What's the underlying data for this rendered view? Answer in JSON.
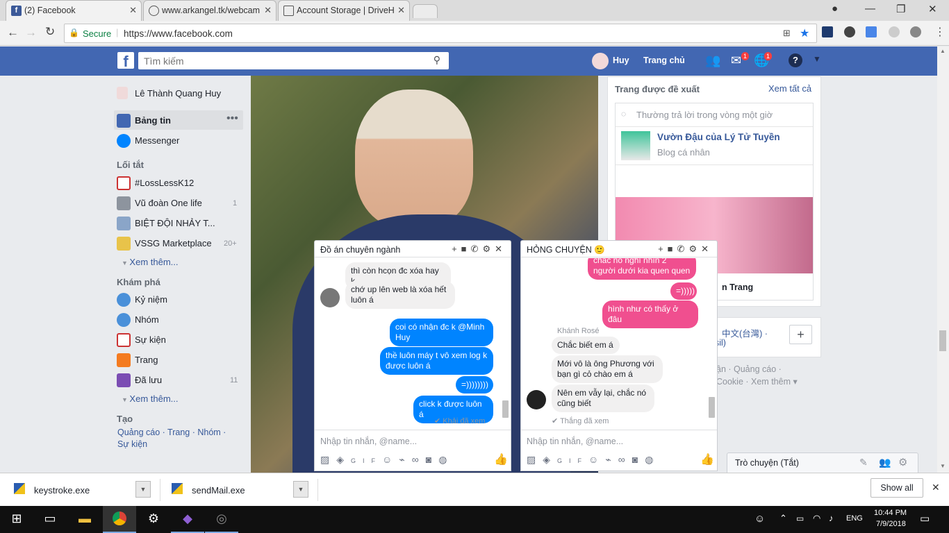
{
  "browser": {
    "tabs": [
      {
        "title": "(2) Facebook"
      },
      {
        "title": "www.arkangel.tk/webcam"
      },
      {
        "title": "Account Storage | DriveH"
      }
    ],
    "secure_label": "Secure",
    "url": "https://www.facebook.com"
  },
  "fb": {
    "search_placeholder": "Tìm kiếm",
    "user": "Huy",
    "home": "Trang chủ",
    "messenger_badge": "1",
    "notif_badge": "1"
  },
  "left": {
    "profile": "Lê Thành Quang Huy",
    "feed": "Bảng tin",
    "messenger": "Messenger",
    "shortcuts_title": "Lối tắt",
    "shortcuts": [
      {
        "label": "#LossLessK12",
        "count": ""
      },
      {
        "label": "Vũ đoàn One life",
        "count": "1"
      },
      {
        "label": "BIỆT ĐỘI NHẢY T...",
        "count": ""
      },
      {
        "label": "VSSG Marketplace",
        "count": "20+"
      }
    ],
    "see_more": "Xem thêm...",
    "explore_title": "Khám phá",
    "explore": [
      {
        "label": "Kỷ niệm",
        "count": ""
      },
      {
        "label": "Nhóm",
        "count": ""
      },
      {
        "label": "Sự kiện",
        "count": ""
      },
      {
        "label": "Trang",
        "count": ""
      },
      {
        "label": "Đã lưu",
        "count": "11"
      }
    ],
    "create_title": "Tạo",
    "create_links": "Quảng cáo · Trang · Nhóm ·",
    "create_links2": "Sự kiện"
  },
  "right": {
    "suggested_title": "Trang được đề xuất",
    "see_all": "Xem tất cả",
    "response_note": "Thường trả lời trong vòng một giờ",
    "page_name": "Vườn Đậu của Lý Tử Tuyền",
    "page_type": "Blog cá nhân",
    "photo_caption": "n Trang",
    "lang": "中文(台灣) ·",
    "lang2": "sil)",
    "footer1": "ận · Quảng cáo ·",
    "footer2": "Cookie · Xem thêm ▾"
  },
  "chat1": {
    "title": "Đồ án chuyên ngành",
    "messages": [
      {
        "text": "thì còn hcọn đc xóa hay k"
      },
      {
        "text": "chớ up lên web là xóa hết luôn á"
      },
      {
        "text": "coi có nhận đc k @Minh Huy"
      },
      {
        "text": "thề luôn máy t vô xem log k được luôn á"
      },
      {
        "text": "=))))))))"
      },
      {
        "text": "click k được luôn á"
      }
    ],
    "seen": "✔ Khải đã xem",
    "composer": "Nhập tin nhắn, @name..."
  },
  "chat2": {
    "title": "HỎNG CHUYỆN 🙂",
    "messages": [
      {
        "text": "chắc nó nghĩ nhìn 2 người dưới kia quen quen"
      },
      {
        "text": "=)))))"
      },
      {
        "text": "hình như có thấy ở đâu"
      },
      {
        "text": "Chắc biết em á"
      },
      {
        "text": "Mới vô là ông Phương với bạn gì cỏ chào em á"
      },
      {
        "text": "Nên em vẫy lại, chắc nó cũng biết"
      }
    ],
    "sender": "Khánh Rosé",
    "seen": "✔ Thắng đã xem",
    "composer": "Nhập tin nhắn, @name..."
  },
  "chat_bar": {
    "label": "Trò chuyện (Tắt)"
  },
  "downloads": {
    "items": [
      {
        "name": "keystroke.exe"
      },
      {
        "name": "sendMail.exe"
      }
    ],
    "show_all": "Show all"
  },
  "taskbar": {
    "lang": "ENG",
    "time": "10:44 PM",
    "date": "7/9/2018"
  },
  "colors": {
    "fb_blue": "#4267b2",
    "messenger_blue": "#0084ff",
    "pink": "#f04f8f"
  }
}
